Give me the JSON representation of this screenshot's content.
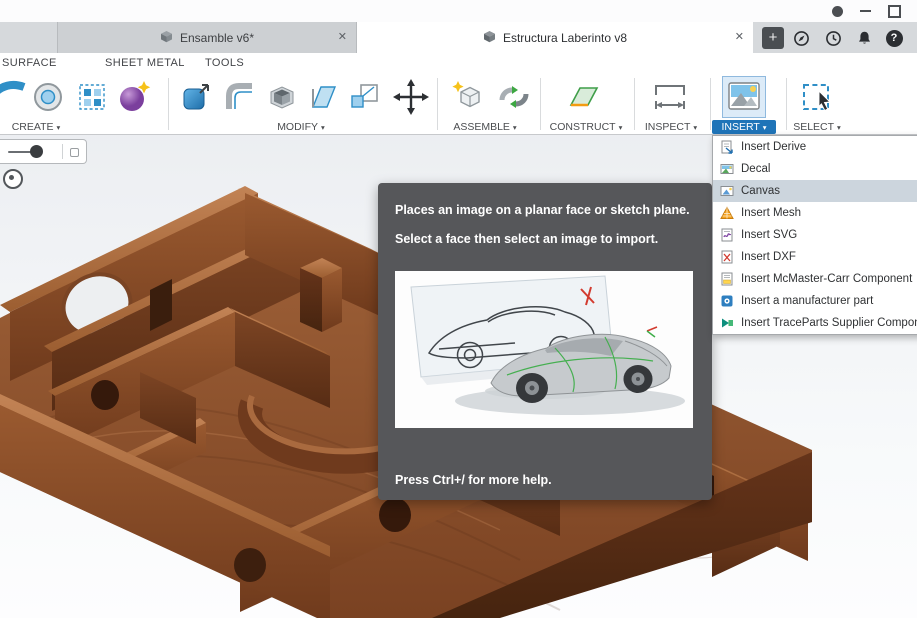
{
  "icons": {
    "close": "✕",
    "plus": "+",
    "caret": "▾",
    "help": "?"
  },
  "colors": {
    "accent_blue": "#1f74b8",
    "menu_highlight": "#ccd5dd",
    "tooltip_bg": "#56575a",
    "wood_mid": "#8a4f2a"
  },
  "tabs": {
    "items": [
      {
        "label": "Ensamble v6*",
        "active": false
      },
      {
        "label": "Estructura Laberinto v8",
        "active": true
      }
    ]
  },
  "context_tabs": [
    "SURFACE",
    "SHEET METAL",
    "TOOLS"
  ],
  "ribbon_groups": [
    {
      "label": "CREATE"
    },
    {
      "label": "MODIFY"
    },
    {
      "label": "ASSEMBLE"
    },
    {
      "label": "CONSTRUCT"
    },
    {
      "label": "INSPECT"
    },
    {
      "label": "INSERT",
      "active": true
    },
    {
      "label": "SELECT"
    }
  ],
  "insert_menu": {
    "items": [
      {
        "label": "Insert Derive"
      },
      {
        "label": "Decal"
      },
      {
        "label": "Canvas",
        "highlighted": true
      },
      {
        "label": "Insert Mesh"
      },
      {
        "label": "Insert SVG"
      },
      {
        "label": "Insert DXF"
      },
      {
        "label": "Insert McMaster-Carr Component"
      },
      {
        "label": "Insert a manufacturer part"
      },
      {
        "label": "Insert TraceParts Supplier Component"
      }
    ]
  },
  "tooltip": {
    "line1": "Places an image on a planar face or sketch plane.",
    "line2": "Select a face then select an image to import.",
    "footer": "Press Ctrl+/ for more help."
  }
}
